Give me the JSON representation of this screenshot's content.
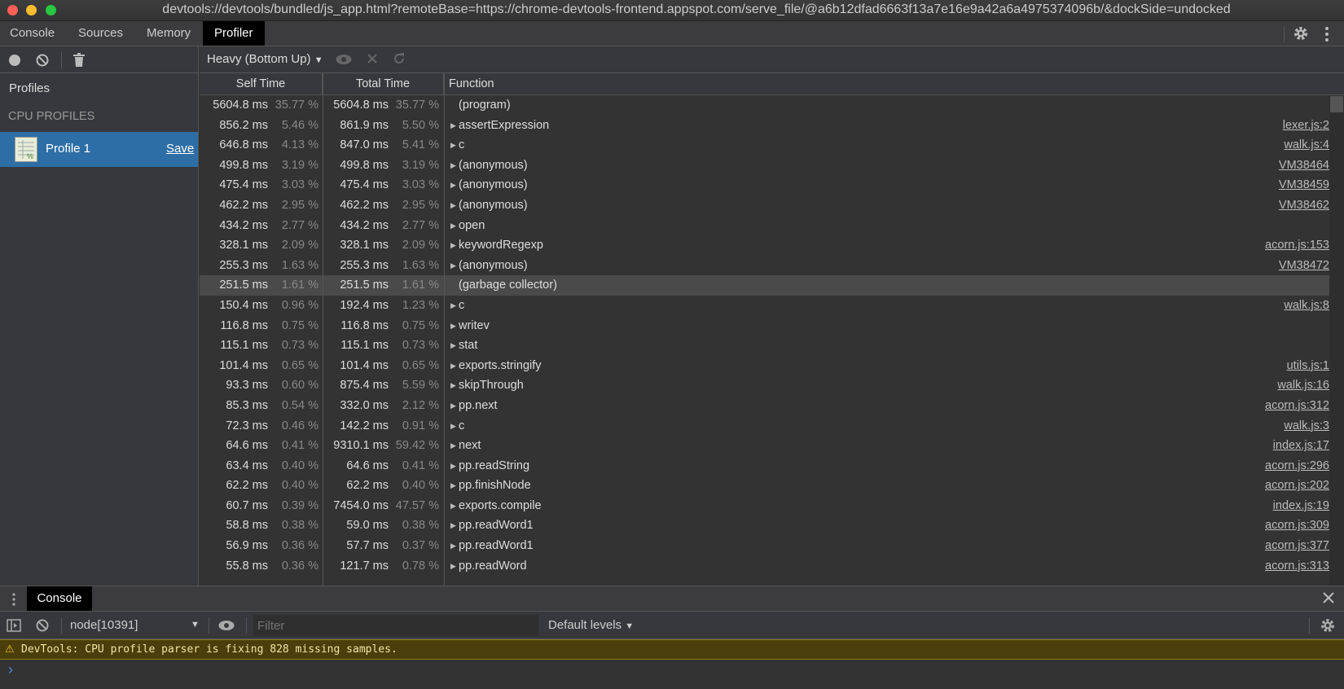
{
  "window": {
    "title": "devtools://devtools/bundled/js_app.html?remoteBase=https://chrome-devtools-frontend.appspot.com/serve_file/@a6b12dfad6663f13a7e16e9a42a6a4975374096b/&dockSide=undocked"
  },
  "tabs": [
    {
      "label": "Console"
    },
    {
      "label": "Sources"
    },
    {
      "label": "Memory"
    },
    {
      "label": "Profiler"
    }
  ],
  "sidebar": {
    "profiles_label": "Profiles",
    "section": "CPU PROFILES",
    "profile": {
      "name": "Profile 1",
      "save": "Save"
    }
  },
  "toolbar": {
    "view_mode": "Heavy (Bottom Up)"
  },
  "grid": {
    "headers": {
      "self": "Self Time",
      "total": "Total Time",
      "function": "Function"
    },
    "rows": [
      {
        "self": "5604.8 ms",
        "self_pct": "35.77 %",
        "total": "5604.8 ms",
        "total_pct": "35.77 %",
        "fn": "(program)",
        "arrow": false,
        "url": ""
      },
      {
        "self": "856.2 ms",
        "self_pct": "5.46 %",
        "total": "861.9 ms",
        "total_pct": "5.50 %",
        "fn": "assertExpression",
        "arrow": true,
        "url": "lexer.js:2"
      },
      {
        "self": "646.8 ms",
        "self_pct": "4.13 %",
        "total": "847.0 ms",
        "total_pct": "5.41 %",
        "fn": "c",
        "arrow": true,
        "url": "walk.js:4"
      },
      {
        "self": "499.8 ms",
        "self_pct": "3.19 %",
        "total": "499.8 ms",
        "total_pct": "3.19 %",
        "fn": "(anonymous)",
        "arrow": true,
        "url": "VM38464"
      },
      {
        "self": "475.4 ms",
        "self_pct": "3.03 %",
        "total": "475.4 ms",
        "total_pct": "3.03 %",
        "fn": "(anonymous)",
        "arrow": true,
        "url": "VM38459"
      },
      {
        "self": "462.2 ms",
        "self_pct": "2.95 %",
        "total": "462.2 ms",
        "total_pct": "2.95 %",
        "fn": "(anonymous)",
        "arrow": true,
        "url": "VM38462"
      },
      {
        "self": "434.2 ms",
        "self_pct": "2.77 %",
        "total": "434.2 ms",
        "total_pct": "2.77 %",
        "fn": "open",
        "arrow": true,
        "url": ""
      },
      {
        "self": "328.1 ms",
        "self_pct": "2.09 %",
        "total": "328.1 ms",
        "total_pct": "2.09 %",
        "fn": "keywordRegexp",
        "arrow": true,
        "url": "acorn.js:153"
      },
      {
        "self": "255.3 ms",
        "self_pct": "1.63 %",
        "total": "255.3 ms",
        "total_pct": "1.63 %",
        "fn": "(anonymous)",
        "arrow": true,
        "url": "VM38472"
      },
      {
        "self": "251.5 ms",
        "self_pct": "1.61 %",
        "total": "251.5 ms",
        "total_pct": "1.61 %",
        "fn": "(garbage collector)",
        "arrow": false,
        "url": "",
        "selected": true
      },
      {
        "self": "150.4 ms",
        "self_pct": "0.96 %",
        "total": "192.4 ms",
        "total_pct": "1.23 %",
        "fn": "c",
        "arrow": true,
        "url": "walk.js:8"
      },
      {
        "self": "116.8 ms",
        "self_pct": "0.75 %",
        "total": "116.8 ms",
        "total_pct": "0.75 %",
        "fn": "writev",
        "arrow": true,
        "url": ""
      },
      {
        "self": "115.1 ms",
        "self_pct": "0.73 %",
        "total": "115.1 ms",
        "total_pct": "0.73 %",
        "fn": "stat",
        "arrow": true,
        "url": ""
      },
      {
        "self": "101.4 ms",
        "self_pct": "0.65 %",
        "total": "101.4 ms",
        "total_pct": "0.65 %",
        "fn": "exports.stringify",
        "arrow": true,
        "url": "utils.js:1"
      },
      {
        "self": "93.3 ms",
        "self_pct": "0.60 %",
        "total": "875.4 ms",
        "total_pct": "5.59 %",
        "fn": "skipThrough",
        "arrow": true,
        "url": "walk.js:16"
      },
      {
        "self": "85.3 ms",
        "self_pct": "0.54 %",
        "total": "332.0 ms",
        "total_pct": "2.12 %",
        "fn": "pp.next",
        "arrow": true,
        "url": "acorn.js:312"
      },
      {
        "self": "72.3 ms",
        "self_pct": "0.46 %",
        "total": "142.2 ms",
        "total_pct": "0.91 %",
        "fn": "c",
        "arrow": true,
        "url": "walk.js:3"
      },
      {
        "self": "64.6 ms",
        "self_pct": "0.41 %",
        "total": "9310.1 ms",
        "total_pct": "59.42 %",
        "fn": "next",
        "arrow": true,
        "url": "index.js:17"
      },
      {
        "self": "63.4 ms",
        "self_pct": "0.40 %",
        "total": "64.6 ms",
        "total_pct": "0.41 %",
        "fn": "pp.readString",
        "arrow": true,
        "url": "acorn.js:296"
      },
      {
        "self": "62.2 ms",
        "self_pct": "0.40 %",
        "total": "62.2 ms",
        "total_pct": "0.40 %",
        "fn": "pp.finishNode",
        "arrow": true,
        "url": "acorn.js:202"
      },
      {
        "self": "60.7 ms",
        "self_pct": "0.39 %",
        "total": "7454.0 ms",
        "total_pct": "47.57 %",
        "fn": "exports.compile",
        "arrow": true,
        "url": "index.js:19"
      },
      {
        "self": "58.8 ms",
        "self_pct": "0.38 %",
        "total": "59.0 ms",
        "total_pct": "0.38 %",
        "fn": "pp.readWord1",
        "arrow": true,
        "url": "acorn.js:309"
      },
      {
        "self": "56.9 ms",
        "self_pct": "0.36 %",
        "total": "57.7 ms",
        "total_pct": "0.37 %",
        "fn": "pp.readWord1",
        "arrow": true,
        "url": "acorn.js:377"
      },
      {
        "self": "55.8 ms",
        "self_pct": "0.36 %",
        "total": "121.7 ms",
        "total_pct": "0.78 %",
        "fn": "pp.readWord",
        "arrow": true,
        "url": "acorn.js:313"
      }
    ]
  },
  "drawer": {
    "tab": "Console",
    "context": "node[10391]",
    "filter_placeholder": "Filter",
    "levels": "Default levels",
    "warning": "DevTools: CPU profile parser is fixing 828 missing samples.",
    "prompt": "›"
  },
  "colors": {
    "selected_tab": "#000000",
    "selected_profile": "#2d6ea6",
    "warning_bg": "#4a3f0b"
  }
}
